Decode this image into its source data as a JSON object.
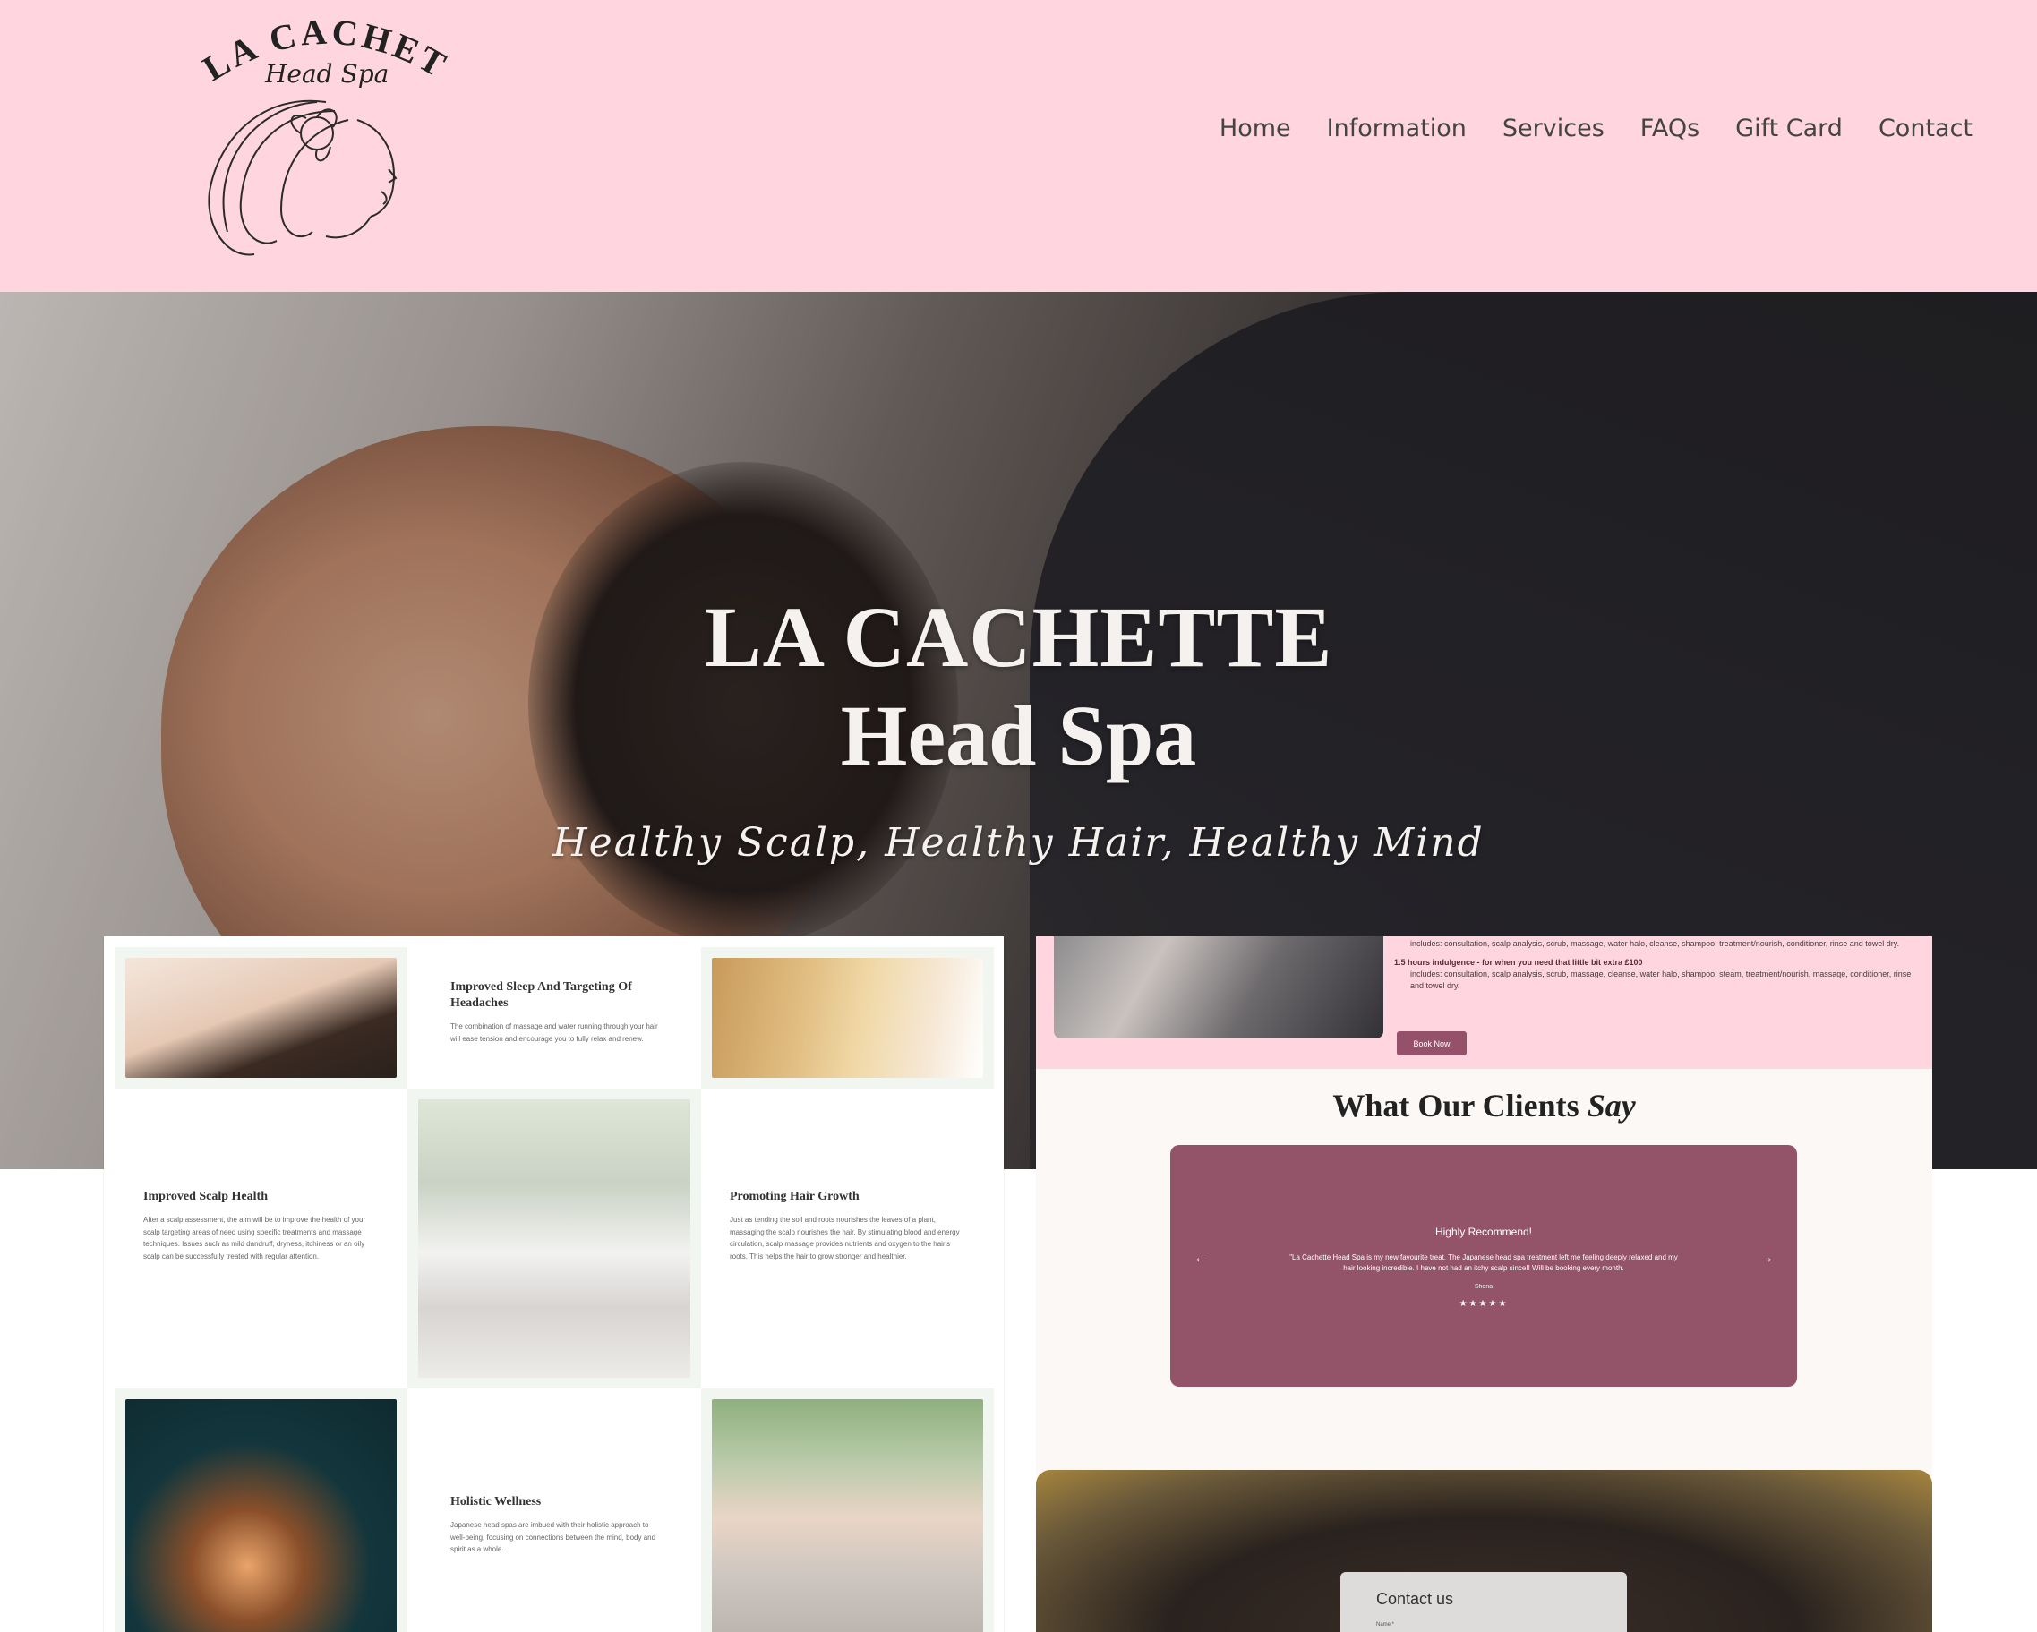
{
  "brand": {
    "logo_line1": "LA CACHETTE",
    "logo_line2": "Head Spa"
  },
  "nav": [
    "Home",
    "Information",
    "Services",
    "FAQs",
    "Gift Card",
    "Contact"
  ],
  "hero": {
    "title_line1": "LA CACHETTE",
    "title_line2": "Head Spa",
    "tagline": "Healthy Scalp, Healthy Hair, Healthy Mind"
  },
  "benefits": {
    "sleep": {
      "title": "Improved Sleep And Targeting Of Headaches",
      "text": "The combination of massage and water running through your hair will ease tension and encourage you to fully relax and renew."
    },
    "scalp": {
      "title": "Improved Scalp Health",
      "text": "After a scalp assessment, the aim will be to improve the health of your scalp targeting areas of need using specific treatments and massage techniques. Issues such as mild dandruff, dryness, itchiness or an oily scalp can be successfully treated with regular attention."
    },
    "growth": {
      "title": "Promoting Hair Growth",
      "text": "Just as tending the soil and roots nourishes the leaves of a plant, massaging the scalp nourishes the hair. By stimulating blood and energy circulation, scalp massage provides nutrients and oxygen to the hair's roots. This helps the hair to grow stronger and healthier."
    },
    "wellness": {
      "title": "Holistic Wellness",
      "text": "Japanese head spas are imbued with their holistic approach to well-being, focusing on connections between the mind, body and spirit as a whole."
    }
  },
  "services": {
    "item1_includes": "includes: consultation, scalp analysis, scrub, massage, water halo, cleanse, shampoo, treatment/nourish, conditioner, rinse and towel dry.",
    "item2_title": "1.5 hours indulgence - for when you need that little bit extra £100",
    "item2_includes": "includes: consultation, scalp analysis, scrub, massage, cleanse, water halo, shampoo, steam, treatment/nourish, massage, conditioner, rinse and towel dry.",
    "book_button": "Book Now"
  },
  "testimonials": {
    "heading_plain": "What Our Clients",
    "heading_italic": "Say",
    "card_title": "Highly Recommend!",
    "quote": "\"La Cachette Head Spa is my new favourite treat. The Japanese head spa treatment left me feeling deeply relaxed and my hair looking incredible. I have not had an itchy scalp since!! Will be booking every month.",
    "author": "Shona",
    "stars": "★★★★★",
    "prev_arrow": "←",
    "next_arrow": "→"
  },
  "contact": {
    "title": "Contact us",
    "name_label": "Name *"
  },
  "colors": {
    "header_pink": "#ffd6df",
    "mauve": "#935369"
  }
}
